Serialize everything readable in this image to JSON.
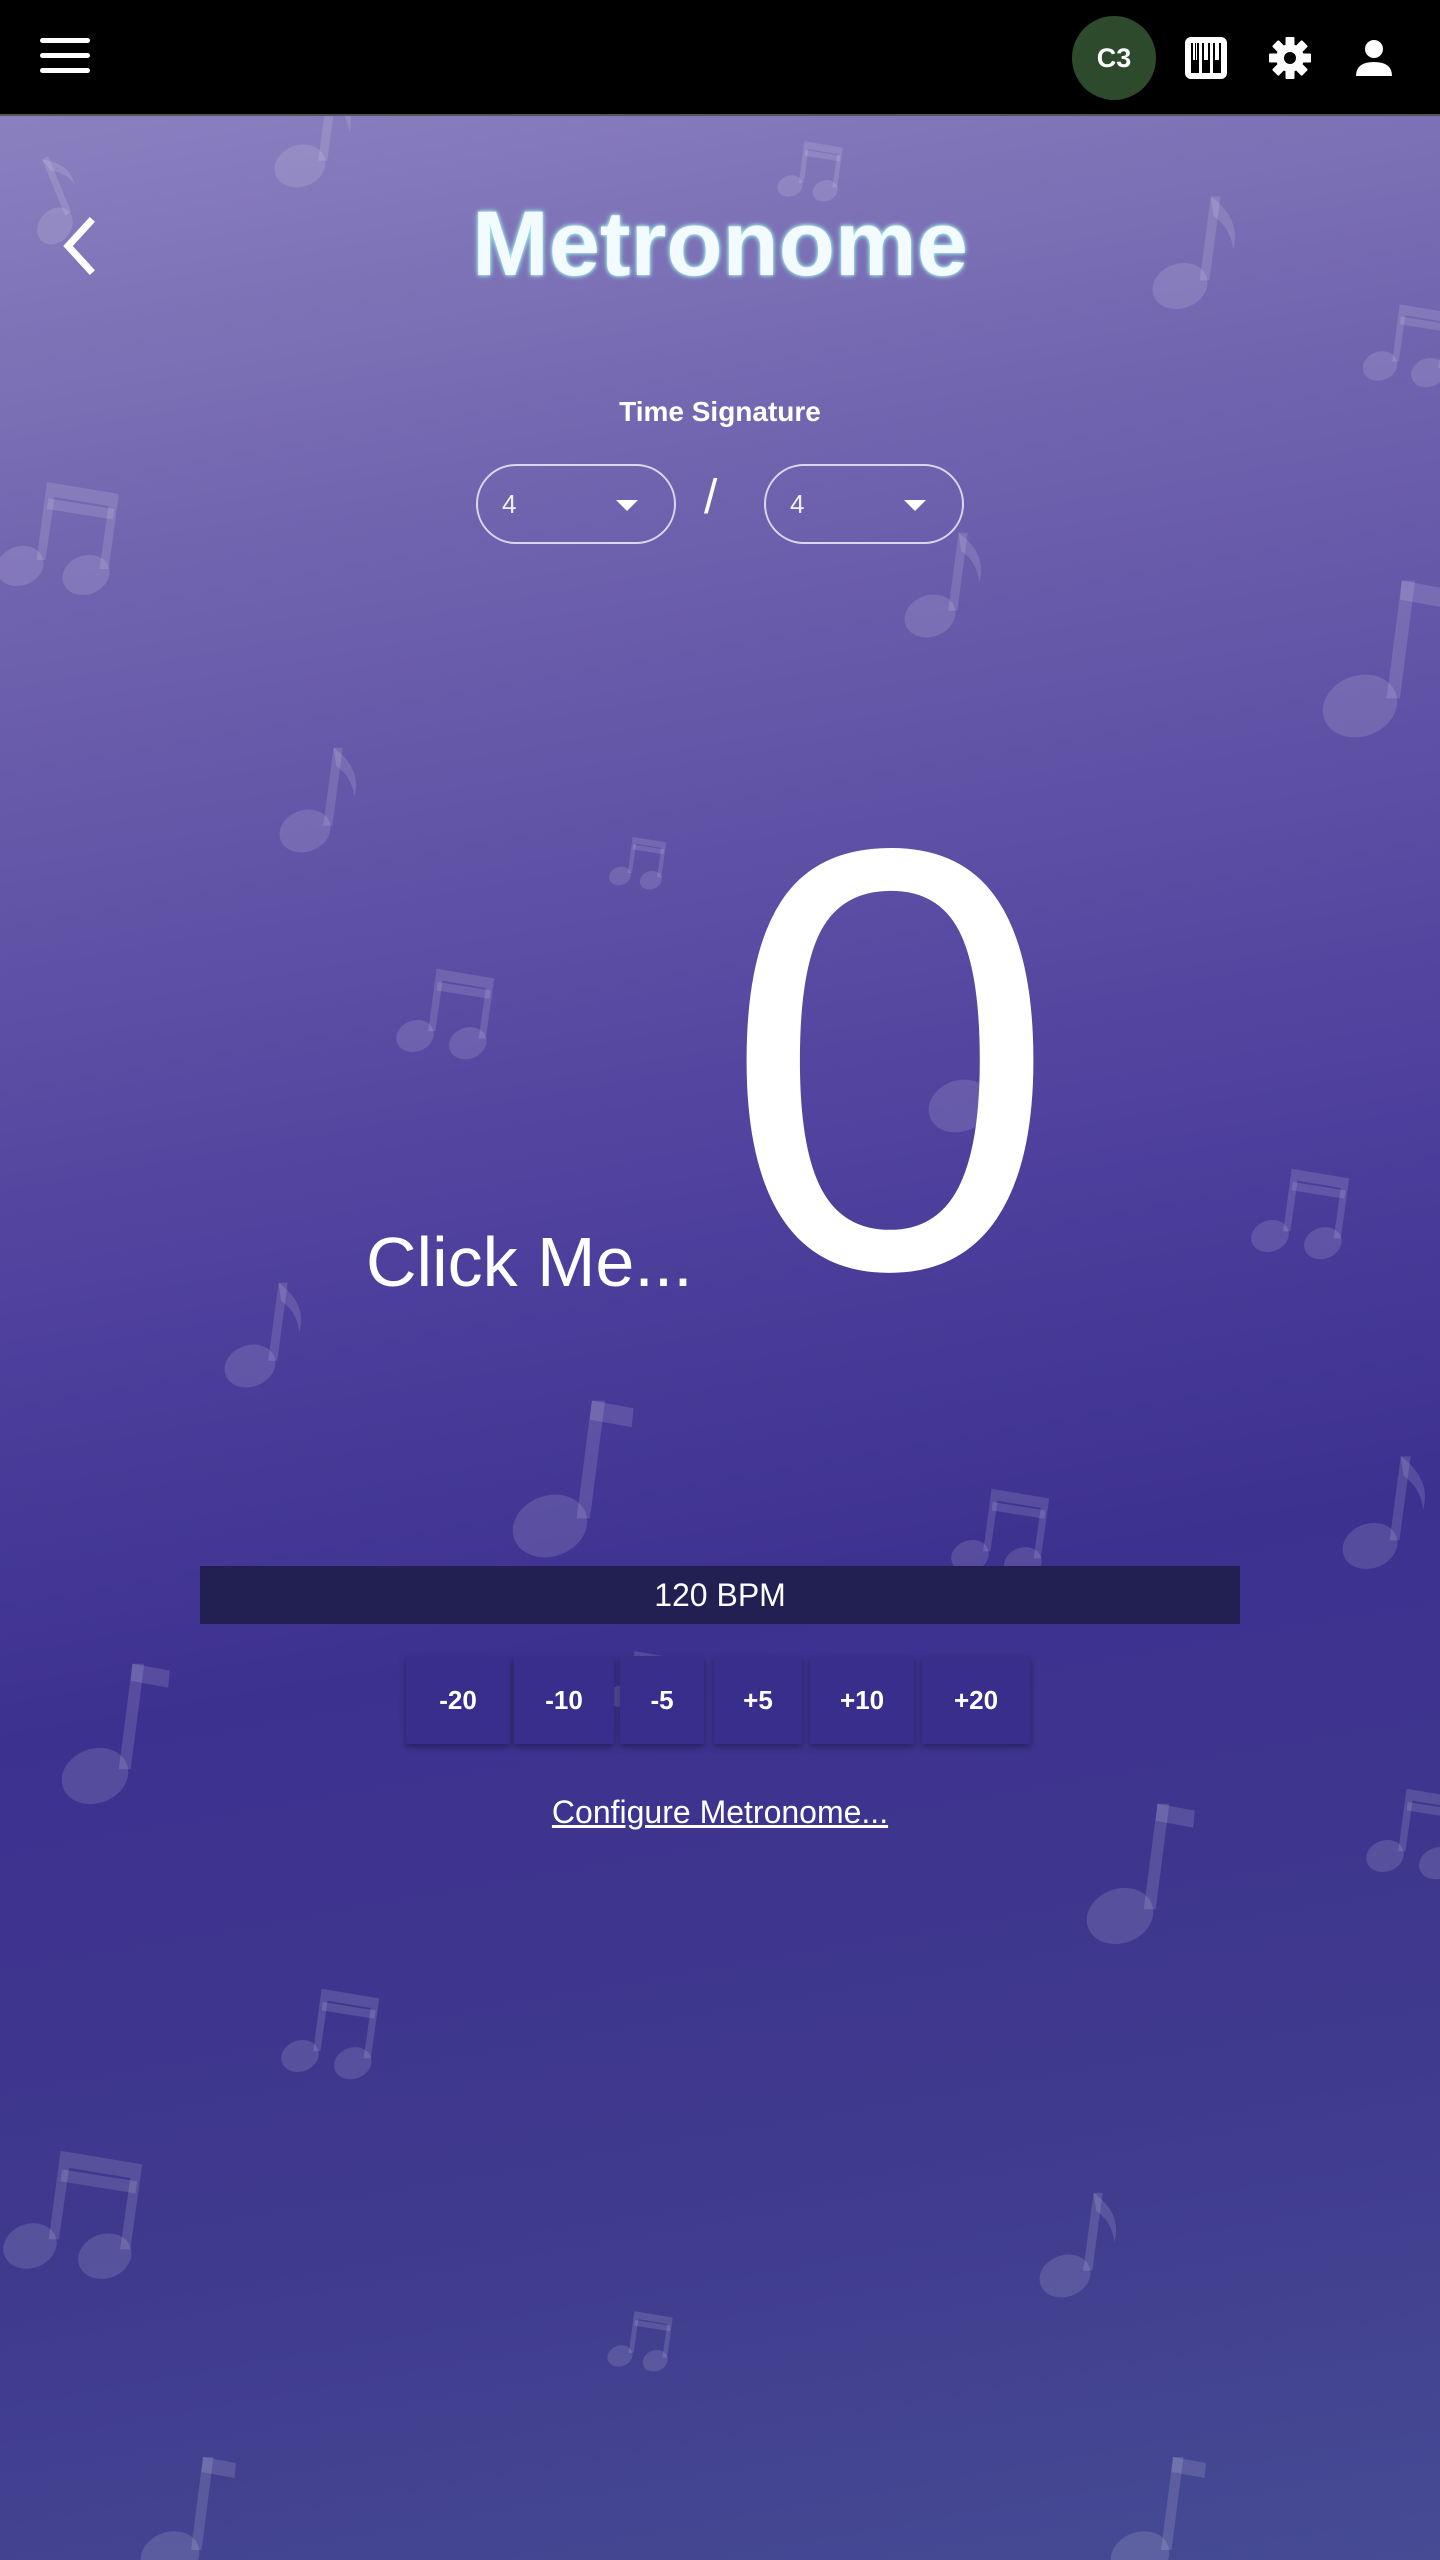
{
  "topbar": {
    "user_initials": "C3",
    "icons": [
      "menu-icon",
      "piano-icon",
      "gear-icon",
      "person-icon"
    ]
  },
  "page": {
    "title": "Metronome",
    "time_signature_label": "Time Signature",
    "beats_per_measure": "4",
    "beat_unit": "4",
    "separator": "/",
    "click_prompt": "Click Me...",
    "current_beat": "0"
  },
  "tempo": {
    "display": "120 BPM",
    "adjust_buttons": [
      "-20",
      "-10",
      "-5",
      "+5",
      "+10",
      "+20"
    ]
  },
  "configure_link": "Configure Metronome...",
  "colors": {
    "topbar": "#000000",
    "avatar": "#2d4a2c",
    "bpm_bar": "#221f52",
    "button": "#3a2e8c",
    "title_glow": "#9ff3ea"
  }
}
